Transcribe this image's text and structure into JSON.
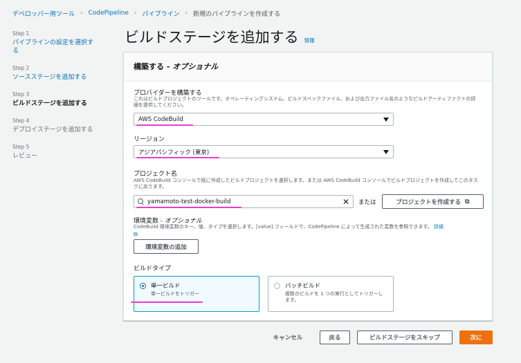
{
  "breadcrumb": [
    "デベロッパー用ツール",
    "CodePipeline",
    "パイプライン",
    "新規のパイプラインを作成する"
  ],
  "steps": [
    {
      "num": "Step 1",
      "label": "パイプラインの設定を選択する",
      "state": "link"
    },
    {
      "num": "Step 2",
      "label": "ソースステージを追加する",
      "state": "link"
    },
    {
      "num": "Step 3",
      "label": "ビルドステージを追加する",
      "state": "active"
    },
    {
      "num": "Step 4",
      "label": "デプロイステージを追加する",
      "state": "disabled"
    },
    {
      "num": "Step 5",
      "label": "レビュー",
      "state": "disabled"
    }
  ],
  "page": {
    "title": "ビルドステージを追加する",
    "info": "情報"
  },
  "panel": {
    "title": "構築する",
    "title_sep": " - ",
    "title_opt": "オプショナル"
  },
  "provider": {
    "label": "プロバイダーを構築する",
    "desc": "これはビルドプロジェクトのツールです。オペレーティングシステム、ビルドスペックファイル、および出力ファイル名のようなビルドアーティファクトの詳細を提供してください。",
    "value": "AWS CodeBuild"
  },
  "region": {
    "label": "リージョン",
    "value": "アジアパシフィック (東京)"
  },
  "project": {
    "label": "プロジェクト名",
    "desc": "AWS CodeBuild コンソールで既に作成したビルドプロジェクトを選択します。または AWS CodeBuild コンソールでビルドプロジェクトを作成してこのタスクに戻ります。",
    "value": "yamamoto-test-docker-build",
    "or": "または",
    "create_button": "プロジェクトを作成する"
  },
  "env": {
    "label": "環境変数",
    "label_sep": " - ",
    "label_opt": "オプショナル",
    "desc": "CodeBuild 環境変数のキー、値、タイプを選択します。[value] フィールドで、CodePipeline によって生成された変数を参照できます。",
    "detail_link": "詳細",
    "add_button": "環境変数の追加"
  },
  "build_type": {
    "label": "ビルドタイプ",
    "options": [
      {
        "title": "単一ビルド",
        "desc": "単一ビルドをトリガー",
        "selected": true
      },
      {
        "title": "バッチビルド",
        "desc": "複数のビルドを 1 つの実行としてトリガーします。",
        "selected": false
      }
    ]
  },
  "footer": {
    "cancel": "キャンセル",
    "back": "戻る",
    "skip": "ビルドステージをスキップ",
    "next": "次に"
  },
  "colors": {
    "link": "#0073bb",
    "primary": "#ec7211",
    "highlight": "#e83ccf",
    "selected_border": "#00a1c9"
  }
}
